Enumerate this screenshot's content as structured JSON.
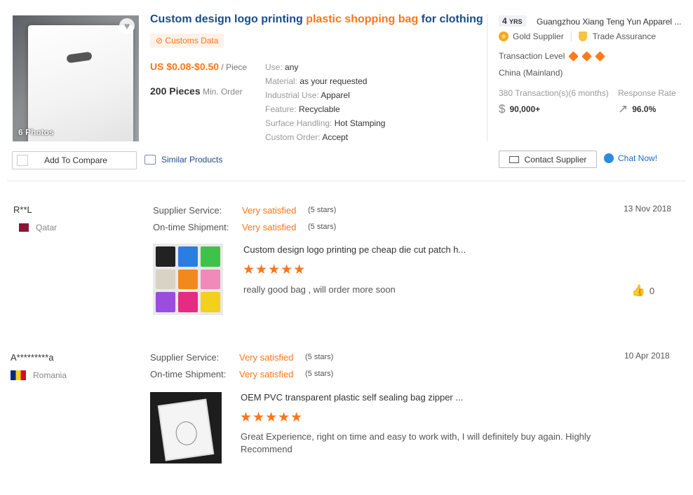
{
  "product": {
    "photos_label": "6 Photos",
    "title_part1": "Custom design logo printing ",
    "title_highlight": "plastic shopping bag",
    "title_part3": " for clothing",
    "customs_label": "Customs Data",
    "price": "US $0.08-$0.50",
    "price_unit": " / Piece",
    "moq": "200 Pieces",
    "moq_unit": " Min. Order",
    "attributes": [
      {
        "key": "Use: ",
        "value": "any"
      },
      {
        "key": "Material: ",
        "value": "as your requested"
      },
      {
        "key": "Industrial Use: ",
        "value": "Apparel"
      },
      {
        "key": "Feature: ",
        "value": "Recyclable"
      },
      {
        "key": "Surface Handling: ",
        "value": "Hot Stamping"
      },
      {
        "key": "Custom Order: ",
        "value": "Accept"
      }
    ],
    "add_to_compare": "Add To Compare",
    "similar_products": "Similar Products"
  },
  "supplier": {
    "years": "4",
    "years_unit": "YRS",
    "company": "Guangzhou Xiang Teng Yun Apparel ...",
    "gold_supplier": "Gold Supplier",
    "trade_assurance": "Trade Assurance",
    "transaction_level": "Transaction Level",
    "transaction_level_diamonds": 3,
    "country": "China (Mainland)",
    "transactions_label": "380 Transaction(s)(6 months)",
    "transactions_value": "90,000+",
    "response_label": "Response Rate",
    "response_value": "96.0%",
    "contact_button": "Contact Supplier",
    "chat_now": "Chat Now!",
    "colors": {
      "accent": "#ff7519",
      "link": "#1a4b8c"
    }
  },
  "reviews": [
    {
      "name": "R**L",
      "country": "Qatar",
      "supplier_service_label": "Supplier Service:",
      "supplier_service_value": "Very satisfied",
      "supplier_service_stars": "(5 stars)",
      "shipment_label": "On-time Shipment:",
      "shipment_value": "Very satisfied",
      "shipment_stars": "(5 stars)",
      "date": "13 Nov 2018",
      "product_title": "Custom design logo printing pe cheap die cut patch h...",
      "rating": 5,
      "stars": "★★★★★",
      "text": "really good bag , will order more soon",
      "likes": "0"
    },
    {
      "name": "A*********a",
      "country": "Romania",
      "supplier_service_label": "Supplier Service:",
      "supplier_service_value": "Very satisfied",
      "supplier_service_stars": "(5 stars)",
      "shipment_label": "On-time Shipment:",
      "shipment_value": "Very satisfied",
      "shipment_stars": "(5 stars)",
      "date": "10 Apr 2018",
      "product_title": "OEM PVC transparent plastic self sealing bag zipper ...",
      "rating": 5,
      "stars": "★★★★★",
      "text": "Great Experience, right on time and easy to work with, I will definitely buy again. Highly Recommend"
    }
  ]
}
